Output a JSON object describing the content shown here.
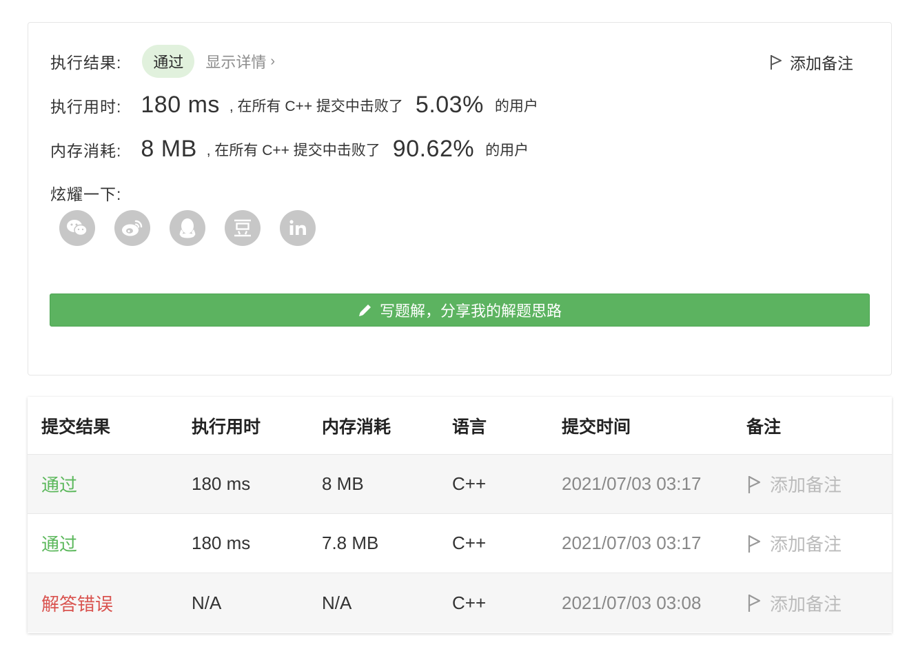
{
  "result": {
    "result_label": "执行结果:",
    "status": "通过",
    "details": "显示详情",
    "add_note": "添加备注",
    "runtime_label": "执行用时:",
    "runtime_value": "180 ms",
    "runtime_mid": ", 在所有 C++ 提交中击败了",
    "runtime_pct": "5.03%",
    "runtime_suffix": "的用户",
    "memory_label": "内存消耗:",
    "memory_value": "8 MB",
    "memory_mid": ", 在所有 C++ 提交中击败了",
    "memory_pct": "90.62%",
    "memory_suffix": "的用户",
    "share_label": "炫耀一下:",
    "share_icons": [
      "wechat-icon",
      "weibo-icon",
      "qq-icon",
      "douban-icon",
      "linkedin-icon"
    ],
    "write_solution": "写题解，分享我的解题思路"
  },
  "table": {
    "headers": [
      "提交结果",
      "执行用时",
      "内存消耗",
      "语言",
      "提交时间",
      "备注"
    ],
    "rows": [
      {
        "status": "通过",
        "status_type": "ok",
        "runtime": "180 ms",
        "memory": "8 MB",
        "language": "C++",
        "time": "2021/07/03 03:17",
        "note": "添加备注"
      },
      {
        "status": "通过",
        "status_type": "ok",
        "runtime": "180 ms",
        "memory": "7.8 MB",
        "language": "C++",
        "time": "2021/07/03 03:17",
        "note": "添加备注"
      },
      {
        "status": "解答错误",
        "status_type": "err",
        "runtime": "N/A",
        "memory": "N/A",
        "language": "C++",
        "time": "2021/07/03 03:08",
        "note": "添加备注"
      }
    ]
  },
  "colors": {
    "success_green": "#5cb85c",
    "error_red": "#d9534f",
    "button_green": "#5cb360",
    "pill_bg": "#e1f1dd"
  }
}
